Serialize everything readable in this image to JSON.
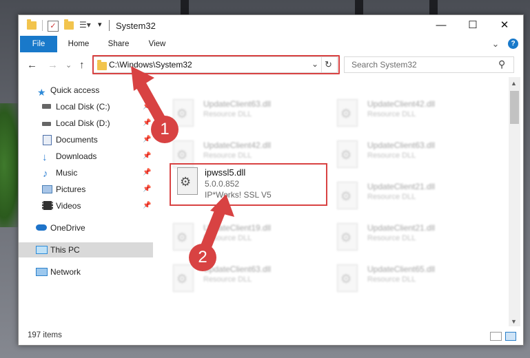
{
  "window": {
    "title": "System32",
    "minimize_icon": "—",
    "maximize_icon": "☐",
    "close_icon": "✕"
  },
  "ribbon": {
    "tabs": [
      "File",
      "Home",
      "Share",
      "View"
    ],
    "collapse_icon": "⌄",
    "help_icon": "?"
  },
  "nav": {
    "back_icon": "←",
    "forward_icon": "→",
    "recent_icon": "⌄",
    "up_icon": "↑",
    "address": "C:\\Windows\\System32",
    "address_dropdown_icon": "⌄",
    "refresh_icon": "↻",
    "search_placeholder": "Search System32",
    "search_icon": "⚲"
  },
  "sidebar": {
    "items": [
      {
        "label": "Quick access",
        "icon": "star",
        "color": "#2e8ad8",
        "pinned": false
      },
      {
        "label": "Local Disk (C:)",
        "icon": "disk",
        "color": "#555555",
        "pinned": true
      },
      {
        "label": "Local Disk (D:)",
        "icon": "disk",
        "color": "#555555",
        "pinned": true
      },
      {
        "label": "Documents",
        "icon": "document",
        "color": "#4b6ea8",
        "pinned": true
      },
      {
        "label": "Downloads",
        "icon": "download",
        "color": "#2e7fd2",
        "pinned": true
      },
      {
        "label": "Music",
        "icon": "music",
        "color": "#2e7fd2",
        "pinned": true
      },
      {
        "label": "Pictures",
        "icon": "picture",
        "color": "#4a7fb5",
        "pinned": true
      },
      {
        "label": "Videos",
        "icon": "video",
        "color": "#333333",
        "pinned": true
      },
      {
        "label": "OneDrive",
        "icon": "cloud",
        "color": "#1e73c9",
        "pinned": false
      },
      {
        "label": "This PC",
        "icon": "computer",
        "color": "#2a8ad8",
        "pinned": false,
        "selected": true
      },
      {
        "label": "Network",
        "icon": "network",
        "color": "#2a7fc9",
        "pinned": false
      }
    ],
    "pin_icon": "📌"
  },
  "files": {
    "background": [
      {
        "name": "UpdateClient63.dll",
        "desc": "Resource DLL"
      },
      {
        "name": "UpdateClient42.dll",
        "desc": "Resource DLL"
      },
      {
        "name": "UpdateClient42.dll",
        "desc": "Resource DLL"
      },
      {
        "name": "UpdateClient63.dll",
        "desc": "Resource DLL"
      },
      {
        "name": "UpdateClient21.dll",
        "desc": "Resource DLL"
      },
      {
        "name": "UpdateClient19.dll",
        "desc": "Resource DLL"
      },
      {
        "name": "UpdateClient21.dll",
        "desc": "Resource DLL"
      },
      {
        "name": "UpdateClient63.dll",
        "desc": "Resource DLL"
      },
      {
        "name": "UpdateClient65.dll",
        "desc": "Resource DLL"
      }
    ],
    "highlighted": {
      "name": "ipwssl5.dll",
      "version": "5.0.0.852",
      "description": "IP*Works! SSL V5"
    }
  },
  "status": {
    "item_count": "197 items"
  },
  "annotations": {
    "step1": "1",
    "step2": "2",
    "highlight_color": "#d84242"
  }
}
